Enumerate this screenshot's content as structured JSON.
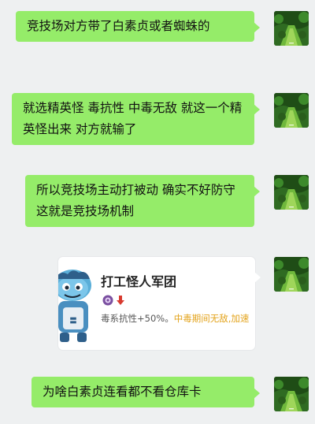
{
  "messages": [
    {
      "text": "竞技场对方带了白素贞或者蜘蛛的"
    },
    {
      "text": "就选精英怪 毒抗性  中毒无敌 就这一个精英怪出来 对方就输了"
    },
    {
      "text": "所以竞技场主动打被动 确实不好防守 这就是竞技场机制"
    },
    {
      "text": "为啥白素贞连看都不看仓库卡"
    }
  ],
  "card": {
    "title": "打工怪人军团",
    "desc_prefix": "毒系抗性+50%。",
    "desc_highlight": "中毒期间无敌,加速"
  },
  "colors": {
    "bubble": "#95ec69",
    "background": "#eef0f1",
    "highlight": "#e3a31b"
  }
}
